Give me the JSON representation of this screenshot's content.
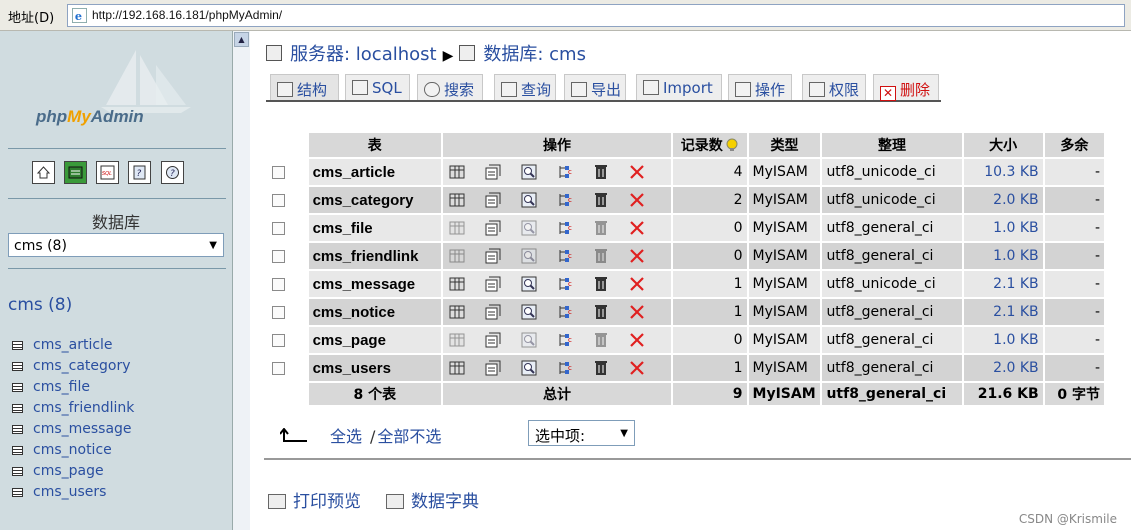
{
  "address_bar": {
    "label": "地址(D)",
    "url": "http://192.168.16.181/phpMyAdmin/"
  },
  "sidebar": {
    "logo_php": "php",
    "logo_my": "My",
    "logo_admin": "Admin",
    "nav_icons": [
      "home-icon",
      "query-window-icon",
      "sql-icon",
      "docs-icon",
      "help-icon"
    ],
    "db_label": "数据库",
    "db_select_value": "cms (8)",
    "db_title": "cms (8)",
    "tables": [
      "cms_article",
      "cms_category",
      "cms_file",
      "cms_friendlink",
      "cms_message",
      "cms_notice",
      "cms_page",
      "cms_users"
    ]
  },
  "breadcrumb": {
    "server_label": "服务器: localhost",
    "db_label": "数据库: cms"
  },
  "tabs": [
    {
      "label": "结构",
      "icon": "structure-icon"
    },
    {
      "label": "SQL",
      "icon": "sql-icon"
    },
    {
      "label": "搜索",
      "icon": "search-icon"
    },
    {
      "label": "查询",
      "icon": "query-icon"
    },
    {
      "label": "导出",
      "icon": "export-icon"
    },
    {
      "label": "Import",
      "icon": "import-icon"
    },
    {
      "label": "操作",
      "icon": "operations-icon"
    },
    {
      "label": "权限",
      "icon": "privileges-icon"
    },
    {
      "label": "删除",
      "icon": "drop-icon"
    }
  ],
  "table": {
    "headers": [
      "表",
      "操作",
      "记录数",
      "类型",
      "整理",
      "大小",
      "多余"
    ],
    "rows": [
      {
        "name": "cms_article",
        "records": "4",
        "type": "MyISAM",
        "collation": "utf8_unicode_ci",
        "size": "10.3 KB",
        "overhead": "-",
        "empty": false
      },
      {
        "name": "cms_category",
        "records": "2",
        "type": "MyISAM",
        "collation": "utf8_unicode_ci",
        "size": "2.0 KB",
        "overhead": "-",
        "empty": false
      },
      {
        "name": "cms_file",
        "records": "0",
        "type": "MyISAM",
        "collation": "utf8_general_ci",
        "size": "1.0 KB",
        "overhead": "-",
        "empty": true
      },
      {
        "name": "cms_friendlink",
        "records": "0",
        "type": "MyISAM",
        "collation": "utf8_general_ci",
        "size": "1.0 KB",
        "overhead": "-",
        "empty": true
      },
      {
        "name": "cms_message",
        "records": "1",
        "type": "MyISAM",
        "collation": "utf8_unicode_ci",
        "size": "2.1 KB",
        "overhead": "-",
        "empty": false
      },
      {
        "name": "cms_notice",
        "records": "1",
        "type": "MyISAM",
        "collation": "utf8_general_ci",
        "size": "2.1 KB",
        "overhead": "-",
        "empty": false
      },
      {
        "name": "cms_page",
        "records": "0",
        "type": "MyISAM",
        "collation": "utf8_general_ci",
        "size": "1.0 KB",
        "overhead": "-",
        "empty": true
      },
      {
        "name": "cms_users",
        "records": "1",
        "type": "MyISAM",
        "collation": "utf8_general_ci",
        "size": "2.0 KB",
        "overhead": "-",
        "empty": false
      }
    ],
    "footer": {
      "count": "8 个表",
      "sum_label": "总计",
      "records": "9",
      "type": "MyISAM",
      "collation": "utf8_general_ci",
      "size": "21.6 KB",
      "overhead": "0 字节"
    }
  },
  "check_all": "全选",
  "uncheck_all": "全部不选",
  "with_selected": "选中项:",
  "print_view": "打印预览",
  "data_dict": "数据字典",
  "watermark": "CSDN @Krismile"
}
